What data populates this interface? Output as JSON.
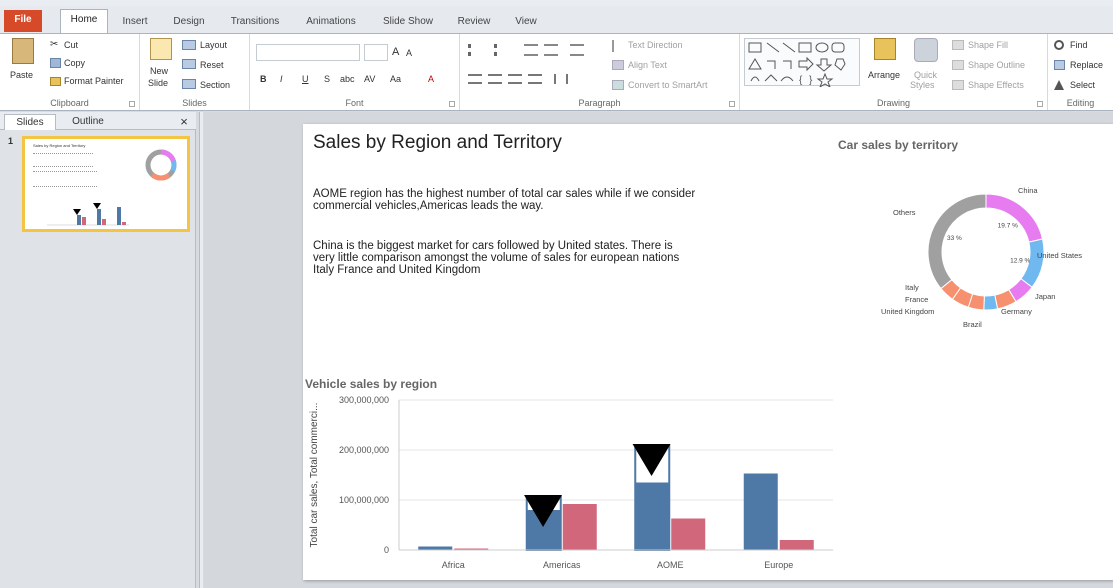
{
  "ribbon_tabs": [
    "File",
    "Home",
    "Insert",
    "Design",
    "Transitions",
    "Animations",
    "Slide Show",
    "Review",
    "View"
  ],
  "active_tab": "Home",
  "clipboard": {
    "paste": "Paste",
    "cut": "Cut",
    "copy": "Copy",
    "format_painter": "Format Painter",
    "label": "Clipboard"
  },
  "slides_group": {
    "new_slide": "New",
    "new_slide2": "Slide",
    "layout": "Layout",
    "reset": "Reset",
    "section": "Section",
    "label": "Slides"
  },
  "font_group": {
    "label": "Font",
    "bold": "B",
    "italic": "I",
    "underline": "U",
    "strike": "S",
    "abc": "abc",
    "spacing": "AV",
    "case": "Aa",
    "color": "A",
    "grow": "A",
    "shrink": "A"
  },
  "paragraph_group": {
    "label": "Paragraph",
    "text_direction": "Text Direction",
    "align_text": "Align Text",
    "convert_smartart": "Convert to SmartArt"
  },
  "drawing_group": {
    "label": "Drawing",
    "arrange": "Arrange",
    "quick": "Quick",
    "styles": "Styles",
    "shape_fill": "Shape Fill",
    "shape_outline": "Shape Outline",
    "shape_effects": "Shape Effects"
  },
  "editing_group": {
    "label": "Editing",
    "find": "Find",
    "replace": "Replace",
    "select": "Select"
  },
  "pane_tabs": {
    "slides": "Slides",
    "outline": "Outline",
    "close": "×"
  },
  "slide_number": "1",
  "slide": {
    "title": "Sales by Region and Territory",
    "para1": "AOME region has the highest number of total car sales while if we consider commercial vehicles,Americas leads the way.",
    "para2": "China is the biggest market for cars followed by United states. There is very little comparison amongst the volume of sales for european nations Italy France and United Kingdom"
  },
  "thumbnail": {
    "title": "Sales by Region and Territory"
  },
  "colors": {
    "blue": "#4e79a7",
    "pink": "#d0677a",
    "grey": "#a0a0a0",
    "magenta": "#e77cf0",
    "lightblue": "#6fb8f0",
    "orange": "#f6906f",
    "file_tab": "#d64a2a",
    "thumb_border": "#f4c542"
  },
  "chart_data": [
    {
      "type": "bar",
      "title": "Vehicle sales by region",
      "ylabel": "Total car sales, Total commerci...",
      "categories": [
        "Africa",
        "Americas",
        "AOME",
        "Europe"
      ],
      "ylim": [
        0,
        300000000
      ],
      "yticks": [
        0,
        100000000,
        200000000,
        300000000
      ],
      "ytick_labels": [
        "0",
        "100,000,000",
        "200,000,000",
        "300,000,000"
      ],
      "series": [
        {
          "values": [
            7000000,
            80000000,
            135000000,
            153000000
          ]
        },
        {
          "values": [
            3000000,
            92000000,
            63000000,
            20000000
          ]
        }
      ],
      "overlay_values": [
        null,
        106000000,
        208000000,
        null
      ],
      "markers": [
        "Americas",
        "AOME"
      ]
    },
    {
      "type": "pie",
      "title": "Car sales by territory",
      "slices": [
        {
          "label": "China",
          "value": 19.7,
          "display": "19.7 %",
          "color": "#e77cf0"
        },
        {
          "label": "United States",
          "value": 12.9,
          "display": "12.9 %",
          "color": "#6fb8f0"
        },
        {
          "label": "Japan",
          "value": 5.5,
          "display": "",
          "color": "#e77cf0"
        },
        {
          "label": "Germany",
          "value": 5.0,
          "display": "",
          "color": "#f6906f"
        },
        {
          "label": "Brazil",
          "value": 3.5,
          "display": "",
          "color": "#6fb8f0"
        },
        {
          "label": "United Kingdom",
          "value": 4.0,
          "display": "",
          "color": "#f6906f"
        },
        {
          "label": "France",
          "value": 4.5,
          "display": "",
          "color": "#f6906f"
        },
        {
          "label": "Italy",
          "value": 4.0,
          "display": "",
          "color": "#f6906f"
        },
        {
          "label": "Others",
          "value": 33,
          "display": "33 %",
          "color": "#a0a0a0"
        }
      ]
    }
  ]
}
